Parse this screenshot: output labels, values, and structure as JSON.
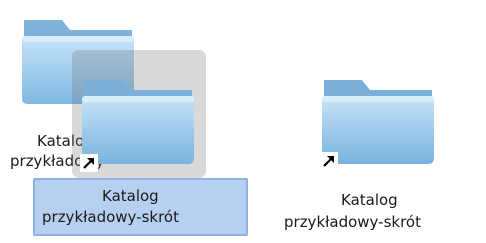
{
  "desktop": {
    "items": [
      {
        "label_line1": "Katalog",
        "label_line2": "przykładowy",
        "alias": false,
        "state": "dragged-from"
      },
      {
        "label_line1": "Katalog",
        "label_line2": "przykładowy-skrót",
        "alias": true,
        "state": "dragging-selected"
      },
      {
        "label_line1": "Katalog",
        "label_line2": "przykładowy-skrót",
        "alias": true,
        "state": "placed"
      }
    ]
  },
  "colors": {
    "folder_light": "#bfe0f6",
    "folder_mid": "#8fc4ea",
    "folder_dark": "#5e9fd0",
    "selection_fill": "#b6d0f0",
    "selection_border": "#8db3e2"
  },
  "icons": [
    "folder-icon",
    "alias-arrow-icon"
  ]
}
